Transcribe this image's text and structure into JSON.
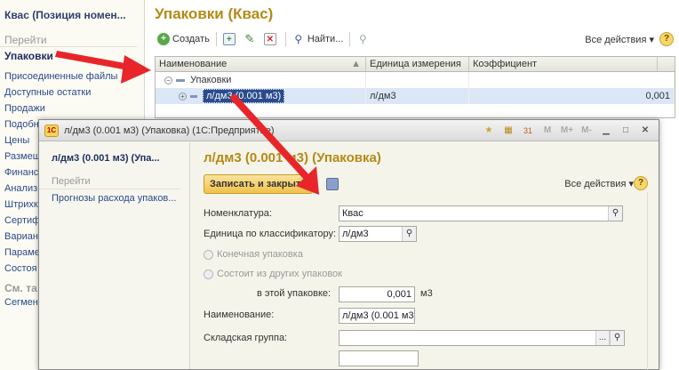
{
  "left_panel": {
    "title": "Квас (Позиция номен...",
    "section_go": "Перейти",
    "active_item": "Упаковки",
    "items": [
      "Присоединенные файлы",
      "Доступные остатки",
      "Продажи",
      "Подобн",
      "Цены",
      "Размещ",
      "Финанс",
      "Анализ",
      "Штрихк",
      "Сертиф",
      "Вариан",
      "Параме",
      "Состоя"
    ],
    "section_see_also": "См. та",
    "section_item": "Сегмен"
  },
  "main": {
    "title": "Упаковки (Квас)",
    "toolbar": {
      "create_label": "Создать",
      "find_label": "Найти...",
      "all_actions_label": "Все действия",
      "help_label": "?"
    },
    "grid": {
      "columns": [
        "Наименование",
        "Единица измерения",
        "Коэффициент"
      ],
      "rows": [
        {
          "name": "Упаковки",
          "unit": "",
          "coef": ""
        },
        {
          "name": "л/дм3 (0.001 м3)",
          "unit": "л/дм3",
          "coef": "0,001"
        }
      ]
    }
  },
  "popup": {
    "window_title": "л/дм3 (0.001 м3) (Упаковка) (1С:Предприятие)",
    "title_icons": [
      "M",
      "M+",
      "M-"
    ],
    "left": {
      "title": "л/дм3 (0.001 м3) (Упа...",
      "section_go": "Перейти",
      "link": "Прогнозы расхода упаков..."
    },
    "form": {
      "title": "л/дм3 (0.001 м3) (Упаковка)",
      "save_close_label": "Записать и закрыть",
      "all_actions_label": "Все действия",
      "help_label": "?",
      "nomenclature_label": "Номенклатура:",
      "nomenclature_value": "Квас",
      "unit_label": "Единица по классификатору:",
      "unit_value": "л/дм3",
      "radio_final": "Конечная упаковка",
      "radio_composite": "Состоит из других упаковок",
      "in_pack_label": "в этой упаковке:",
      "in_pack_value": "0,001",
      "in_pack_unit": "м3",
      "name_label": "Наименование:",
      "name_value": "л/дм3 (0.001 м3)",
      "warehouse_label": "Складская группа:",
      "warehouse_value": "",
      "ellipsis": "..."
    }
  },
  "colors": {
    "title_accent": "#b48a15",
    "selection": "#2a4c8c",
    "arrow": "#e8262a"
  }
}
